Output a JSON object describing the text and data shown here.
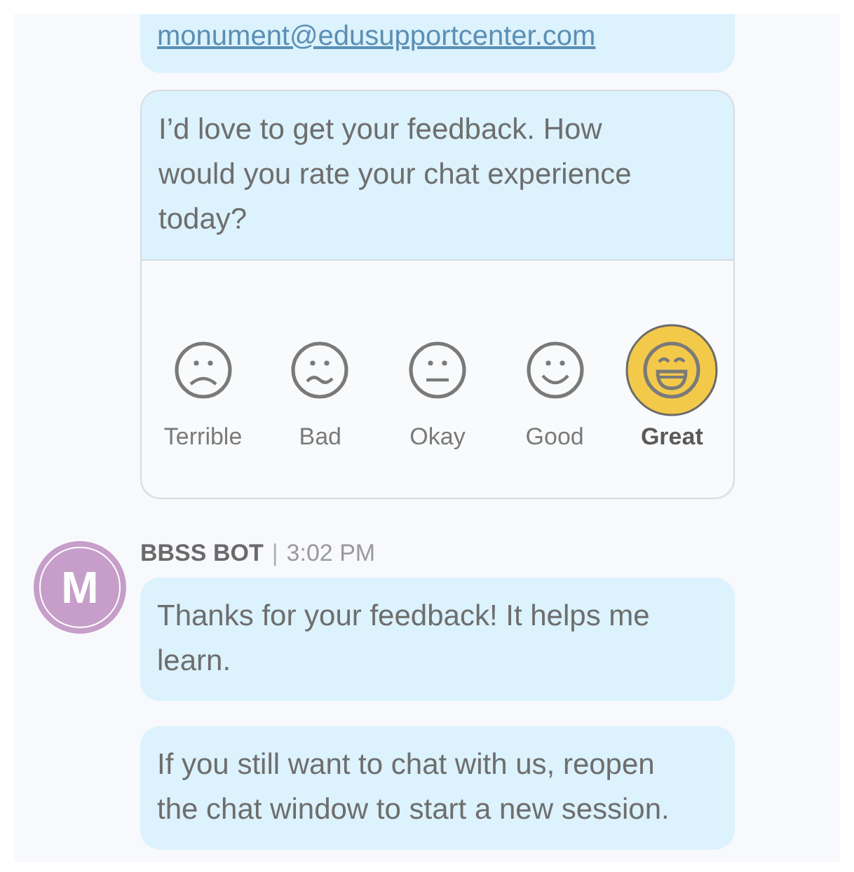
{
  "messages_before": [
    {
      "kind": "link",
      "text": "monument@edusupportcenter.com"
    },
    {
      "kind": "rating",
      "text": "I’d love to get your feedback. How would you rate your chat experience today?",
      "options": [
        {
          "label": "Terrible",
          "kind": "terrible",
          "selected": false
        },
        {
          "label": "Bad",
          "kind": "bad",
          "selected": false
        },
        {
          "label": "Okay",
          "kind": "okay",
          "selected": false
        },
        {
          "label": "Good",
          "kind": "good",
          "selected": false
        },
        {
          "label": "Great",
          "kind": "great",
          "selected": true
        }
      ]
    }
  ],
  "bot_group": {
    "avatar": "M",
    "sender": "BBSS BOT",
    "separator": "|",
    "time": "3:02 PM",
    "messages": [
      {
        "kind": "text",
        "text": "Thanks for your feedback! It helps me learn."
      },
      {
        "kind": "text",
        "text": "If you still want to chat with us, reopen the chat window to start a new session."
      }
    ]
  }
}
